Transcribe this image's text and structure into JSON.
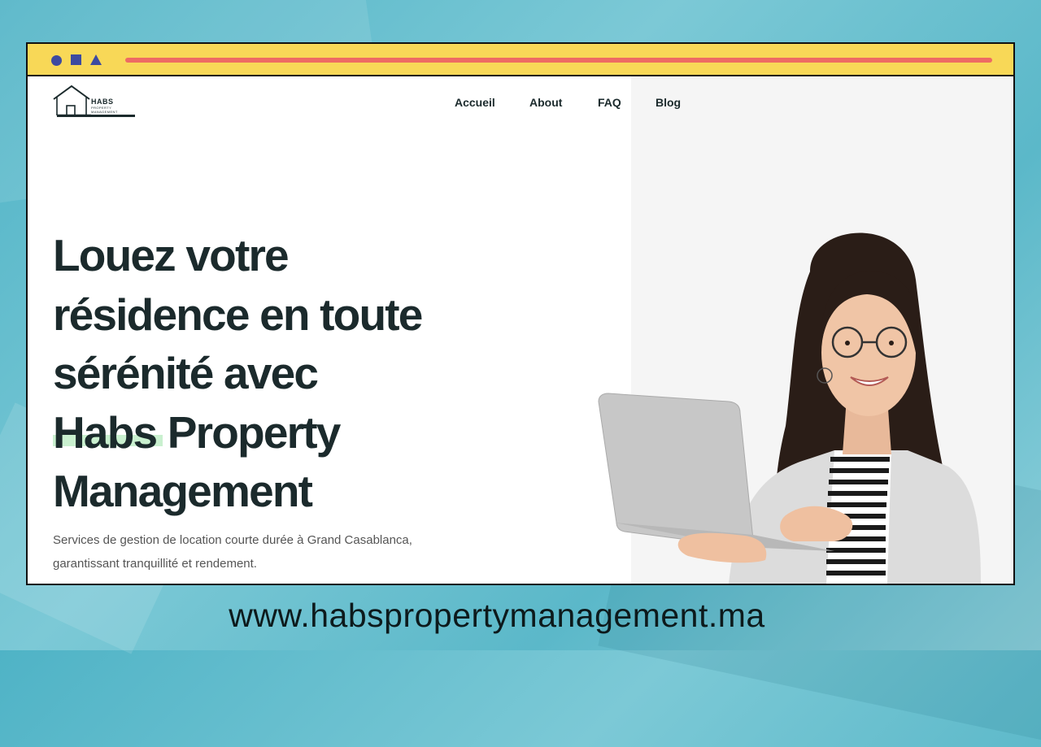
{
  "browser": {
    "colors": {
      "bar": "#f8d857",
      "controls": "#3d4aa0",
      "address": "#ee6b63"
    }
  },
  "logo": {
    "name": "HABS",
    "subtitle": "PROPERTY MANAGEMENT",
    "icon": "house-icon"
  },
  "nav": {
    "items": [
      "Accueil",
      "About",
      "FAQ",
      "Blog"
    ]
  },
  "hero": {
    "title_lines": [
      "Louez votre",
      "résidence en toute",
      "sérénité avec",
      "Habs",
      " Property",
      "Management"
    ],
    "highlight_color": "#c9f0cf",
    "description_lines": [
      "Services de gestion de location courte durée à Grand Casablanca,",
      "garantissant tranquillité et rendement."
    ],
    "image": "woman-with-laptop-photo"
  },
  "footer": {
    "website": "www.habspropertymanagement.ma"
  }
}
